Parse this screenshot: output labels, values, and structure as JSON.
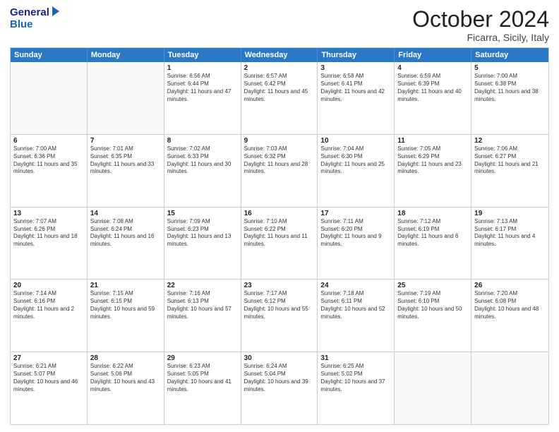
{
  "header": {
    "logo_line1": "General",
    "logo_line2": "Blue",
    "month": "October 2024",
    "location": "Ficarra, Sicily, Italy"
  },
  "days_of_week": [
    "Sunday",
    "Monday",
    "Tuesday",
    "Wednesday",
    "Thursday",
    "Friday",
    "Saturday"
  ],
  "rows": [
    {
      "cells": [
        {
          "day": "",
          "text": ""
        },
        {
          "day": "",
          "text": ""
        },
        {
          "day": "1",
          "text": "Sunrise: 6:56 AM\nSunset: 6:44 PM\nDaylight: 11 hours and 47 minutes."
        },
        {
          "day": "2",
          "text": "Sunrise: 6:57 AM\nSunset: 6:42 PM\nDaylight: 11 hours and 45 minutes."
        },
        {
          "day": "3",
          "text": "Sunrise: 6:58 AM\nSunset: 6:41 PM\nDaylight: 11 hours and 42 minutes."
        },
        {
          "day": "4",
          "text": "Sunrise: 6:59 AM\nSunset: 6:39 PM\nDaylight: 11 hours and 40 minutes."
        },
        {
          "day": "5",
          "text": "Sunrise: 7:00 AM\nSunset: 6:38 PM\nDaylight: 11 hours and 38 minutes."
        }
      ]
    },
    {
      "cells": [
        {
          "day": "6",
          "text": "Sunrise: 7:00 AM\nSunset: 6:36 PM\nDaylight: 11 hours and 35 minutes."
        },
        {
          "day": "7",
          "text": "Sunrise: 7:01 AM\nSunset: 6:35 PM\nDaylight: 11 hours and 33 minutes."
        },
        {
          "day": "8",
          "text": "Sunrise: 7:02 AM\nSunset: 6:33 PM\nDaylight: 11 hours and 30 minutes."
        },
        {
          "day": "9",
          "text": "Sunrise: 7:03 AM\nSunset: 6:32 PM\nDaylight: 11 hours and 28 minutes."
        },
        {
          "day": "10",
          "text": "Sunrise: 7:04 AM\nSunset: 6:30 PM\nDaylight: 11 hours and 25 minutes."
        },
        {
          "day": "11",
          "text": "Sunrise: 7:05 AM\nSunset: 6:29 PM\nDaylight: 11 hours and 23 minutes."
        },
        {
          "day": "12",
          "text": "Sunrise: 7:06 AM\nSunset: 6:27 PM\nDaylight: 11 hours and 21 minutes."
        }
      ]
    },
    {
      "cells": [
        {
          "day": "13",
          "text": "Sunrise: 7:07 AM\nSunset: 6:26 PM\nDaylight: 11 hours and 18 minutes."
        },
        {
          "day": "14",
          "text": "Sunrise: 7:08 AM\nSunset: 6:24 PM\nDaylight: 11 hours and 16 minutes."
        },
        {
          "day": "15",
          "text": "Sunrise: 7:09 AM\nSunset: 6:23 PM\nDaylight: 11 hours and 13 minutes."
        },
        {
          "day": "16",
          "text": "Sunrise: 7:10 AM\nSunset: 6:22 PM\nDaylight: 11 hours and 11 minutes."
        },
        {
          "day": "17",
          "text": "Sunrise: 7:11 AM\nSunset: 6:20 PM\nDaylight: 11 hours and 9 minutes."
        },
        {
          "day": "18",
          "text": "Sunrise: 7:12 AM\nSunset: 6:19 PM\nDaylight: 11 hours and 6 minutes."
        },
        {
          "day": "19",
          "text": "Sunrise: 7:13 AM\nSunset: 6:17 PM\nDaylight: 11 hours and 4 minutes."
        }
      ]
    },
    {
      "cells": [
        {
          "day": "20",
          "text": "Sunrise: 7:14 AM\nSunset: 6:16 PM\nDaylight: 11 hours and 2 minutes."
        },
        {
          "day": "21",
          "text": "Sunrise: 7:15 AM\nSunset: 6:15 PM\nDaylight: 10 hours and 59 minutes."
        },
        {
          "day": "22",
          "text": "Sunrise: 7:16 AM\nSunset: 6:13 PM\nDaylight: 10 hours and 57 minutes."
        },
        {
          "day": "23",
          "text": "Sunrise: 7:17 AM\nSunset: 6:12 PM\nDaylight: 10 hours and 55 minutes."
        },
        {
          "day": "24",
          "text": "Sunrise: 7:18 AM\nSunset: 6:11 PM\nDaylight: 10 hours and 52 minutes."
        },
        {
          "day": "25",
          "text": "Sunrise: 7:19 AM\nSunset: 6:10 PM\nDaylight: 10 hours and 50 minutes."
        },
        {
          "day": "26",
          "text": "Sunrise: 7:20 AM\nSunset: 6:08 PM\nDaylight: 10 hours and 48 minutes."
        }
      ]
    },
    {
      "cells": [
        {
          "day": "27",
          "text": "Sunrise: 6:21 AM\nSunset: 5:07 PM\nDaylight: 10 hours and 46 minutes."
        },
        {
          "day": "28",
          "text": "Sunrise: 6:22 AM\nSunset: 5:06 PM\nDaylight: 10 hours and 43 minutes."
        },
        {
          "day": "29",
          "text": "Sunrise: 6:23 AM\nSunset: 5:05 PM\nDaylight: 10 hours and 41 minutes."
        },
        {
          "day": "30",
          "text": "Sunrise: 6:24 AM\nSunset: 5:04 PM\nDaylight: 10 hours and 39 minutes."
        },
        {
          "day": "31",
          "text": "Sunrise: 6:25 AM\nSunset: 5:02 PM\nDaylight: 10 hours and 37 minutes."
        },
        {
          "day": "",
          "text": ""
        },
        {
          "day": "",
          "text": ""
        }
      ]
    }
  ]
}
